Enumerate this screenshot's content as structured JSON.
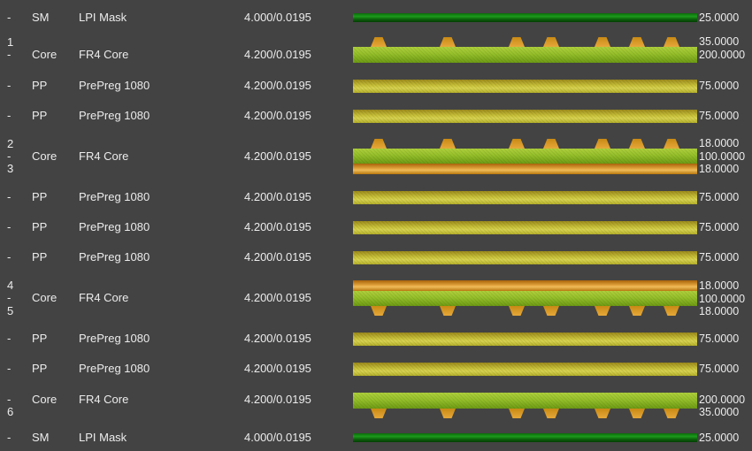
{
  "layers": [
    {
      "num": "-",
      "type": "SM",
      "material": "LPI Mask",
      "dk_df": "4.000/0.0195",
      "thickness": "25.0000"
    },
    {
      "num": "1",
      "top_copper": "35.0000"
    },
    {
      "num": "-",
      "type": "Core",
      "material": "FR4 Core",
      "dk_df": "4.200/0.0195",
      "thickness": "200.0000"
    },
    {
      "num": "-",
      "type": "PP",
      "material": "PrePreg 1080",
      "dk_df": "4.200/0.0195",
      "thickness": "75.0000"
    },
    {
      "num": "-",
      "type": "PP",
      "material": "PrePreg 1080",
      "dk_df": "4.200/0.0195",
      "thickness": "75.0000"
    },
    {
      "num": "2",
      "top_copper": "18.0000"
    },
    {
      "num": "-",
      "type": "Core",
      "material": "FR4 Core",
      "dk_df": "4.200/0.0195",
      "thickness": "100.0000"
    },
    {
      "num": "3",
      "bottom_copper": "18.0000"
    },
    {
      "num": "-",
      "type": "PP",
      "material": "PrePreg 1080",
      "dk_df": "4.200/0.0195",
      "thickness": "75.0000"
    },
    {
      "num": "-",
      "type": "PP",
      "material": "PrePreg 1080",
      "dk_df": "4.200/0.0195",
      "thickness": "75.0000"
    },
    {
      "num": "-",
      "type": "PP",
      "material": "PrePreg 1080",
      "dk_df": "4.200/0.0195",
      "thickness": "75.0000"
    },
    {
      "num": "4",
      "top_copper": "18.0000"
    },
    {
      "num": "-",
      "type": "Core",
      "material": "FR4 Core",
      "dk_df": "4.200/0.0195",
      "thickness": "100.0000"
    },
    {
      "num": "5",
      "bottom_copper": "18.0000"
    },
    {
      "num": "-",
      "type": "PP",
      "material": "PrePreg 1080",
      "dk_df": "4.200/0.0195",
      "thickness": "75.0000"
    },
    {
      "num": "-",
      "type": "PP",
      "material": "PrePreg 1080",
      "dk_df": "4.200/0.0195",
      "thickness": "75.0000"
    },
    {
      "num": "-",
      "type": "Core",
      "material": "FR4 Core",
      "dk_df": "4.200/0.0195",
      "thickness": "200.0000"
    },
    {
      "num": "6",
      "bottom_copper": "35.0000"
    },
    {
      "num": "-",
      "type": "SM",
      "material": "LPI Mask",
      "dk_df": "4.000/0.0195",
      "thickness": "25.0000"
    }
  ],
  "colors": {
    "background": "#434343",
    "solder_mask": "#1c9a1c",
    "core": "#95bf2a",
    "prepreg": "#c9c23a",
    "copper": "#e0a13a"
  }
}
